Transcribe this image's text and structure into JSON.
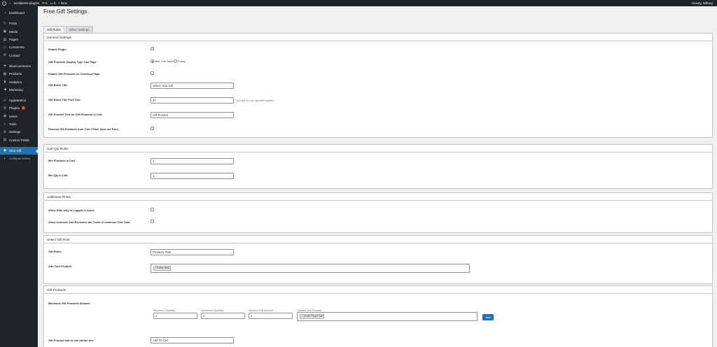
{
  "adminbar": {
    "site_name": "wordpress-plugins",
    "updates_count": "5",
    "comments_count": "0",
    "new_label": "New",
    "howdy": "Howdy, Nilburg"
  },
  "sidebar": {
    "items": [
      {
        "label": "Dashboard",
        "icon": "dashboard-icon",
        "glyph": "◔"
      },
      {
        "label": "Posts",
        "icon": "pin-icon",
        "glyph": "✎"
      },
      {
        "label": "Media",
        "icon": "media-icon",
        "glyph": "▣"
      },
      {
        "label": "Pages",
        "icon": "pages-icon",
        "glyph": "▤"
      },
      {
        "label": "Comments",
        "icon": "comment-icon",
        "glyph": "▭"
      },
      {
        "label": "Contact",
        "icon": "mail-icon",
        "glyph": "✉"
      },
      {
        "label": "WooCommerce",
        "icon": "woo-icon",
        "glyph": "▰"
      },
      {
        "label": "Products",
        "icon": "products-icon",
        "glyph": "▦"
      },
      {
        "label": "Analytics",
        "icon": "analytics-icon",
        "glyph": "▮"
      },
      {
        "label": "Marketing",
        "icon": "megaphone-icon",
        "glyph": "◀"
      },
      {
        "label": "Appearance",
        "icon": "brush-icon",
        "glyph": "✐"
      },
      {
        "label": "Plugins",
        "icon": "plugin-icon",
        "glyph": "⚙",
        "badge": "3"
      },
      {
        "label": "Users",
        "icon": "user-icon",
        "glyph": "◉"
      },
      {
        "label": "Tools",
        "icon": "wrench-icon",
        "glyph": "✧"
      },
      {
        "label": "Settings",
        "icon": "settings-icon",
        "glyph": "⚙"
      },
      {
        "label": "Custom Fields",
        "icon": "fields-icon",
        "glyph": "▤"
      },
      {
        "label": "Woo Gift",
        "icon": "gift-icon",
        "glyph": "◆"
      },
      {
        "label": "Collapse menu",
        "icon": "collapse-icon",
        "glyph": "◐"
      }
    ]
  },
  "page": {
    "title": "Free Gift Settings",
    "tabs": [
      {
        "label": "Gift Rules"
      },
      {
        "label": "Other Settings"
      }
    ]
  },
  "general": {
    "heading": "General Settings",
    "enable_plugin_label": "Enable Plugin",
    "display_type_label": "Gift Products Display Type Cart Page",
    "display_option_1": "After Cart Table",
    "display_option_2": "Popup",
    "enable_checkout_label": "Enable Gift Products on Checkout Page",
    "block_title_label": "Gift Block Title",
    "block_title_value": "Select Your Gift",
    "font_size_label": "Gift Block Title Font Size",
    "font_size_value": "24",
    "font_size_hint": "(font size is in px, just enter number)",
    "product_text_label": "Gift Product Text for Gift Products in Cart",
    "product_text_value": "Gift Product",
    "remove_label": "Remove Gift Products from Cart if Rule does not Pass"
  },
  "cart_qty": {
    "heading": "Cart Qty Rules",
    "min_products_label": "Min Products in Cart",
    "min_products_value": "1",
    "min_qty_label": "Min Qty in Cart",
    "min_qty_value": "1"
  },
  "additional": {
    "heading": "Additional Rules",
    "logged_in_label": "Allow Gifts only to Logged in Users",
    "tax_label": "Allow Inclusive And Exclusive tax Count in minimum Cart Total"
  },
  "select_rule": {
    "heading": "Select Gift Rule",
    "gift_rules_label": "Gift Rules",
    "gift_rules_value": "Products Rule",
    "add_product_label": "Add Your Product",
    "product_tag": "× Fabric Sofa"
  },
  "gift_products": {
    "heading": "Gift Products",
    "max_label": "Maximum Gift Products Allowed",
    "min_qty_label": "Minimum Quantity",
    "min_qty_value": "1",
    "max_qty_label": "Maximum Quantity",
    "max_qty_value": "2",
    "allowed_label": "Allowed Gift product",
    "allowed_value": "2",
    "choose_label": "Choose Gift Product",
    "choose_tag": "× 15 Mix Phone Call",
    "add_button": "Add",
    "cart_button_label": "Gift Product add to cart button text",
    "cart_button_value": "Add To Cart"
  }
}
